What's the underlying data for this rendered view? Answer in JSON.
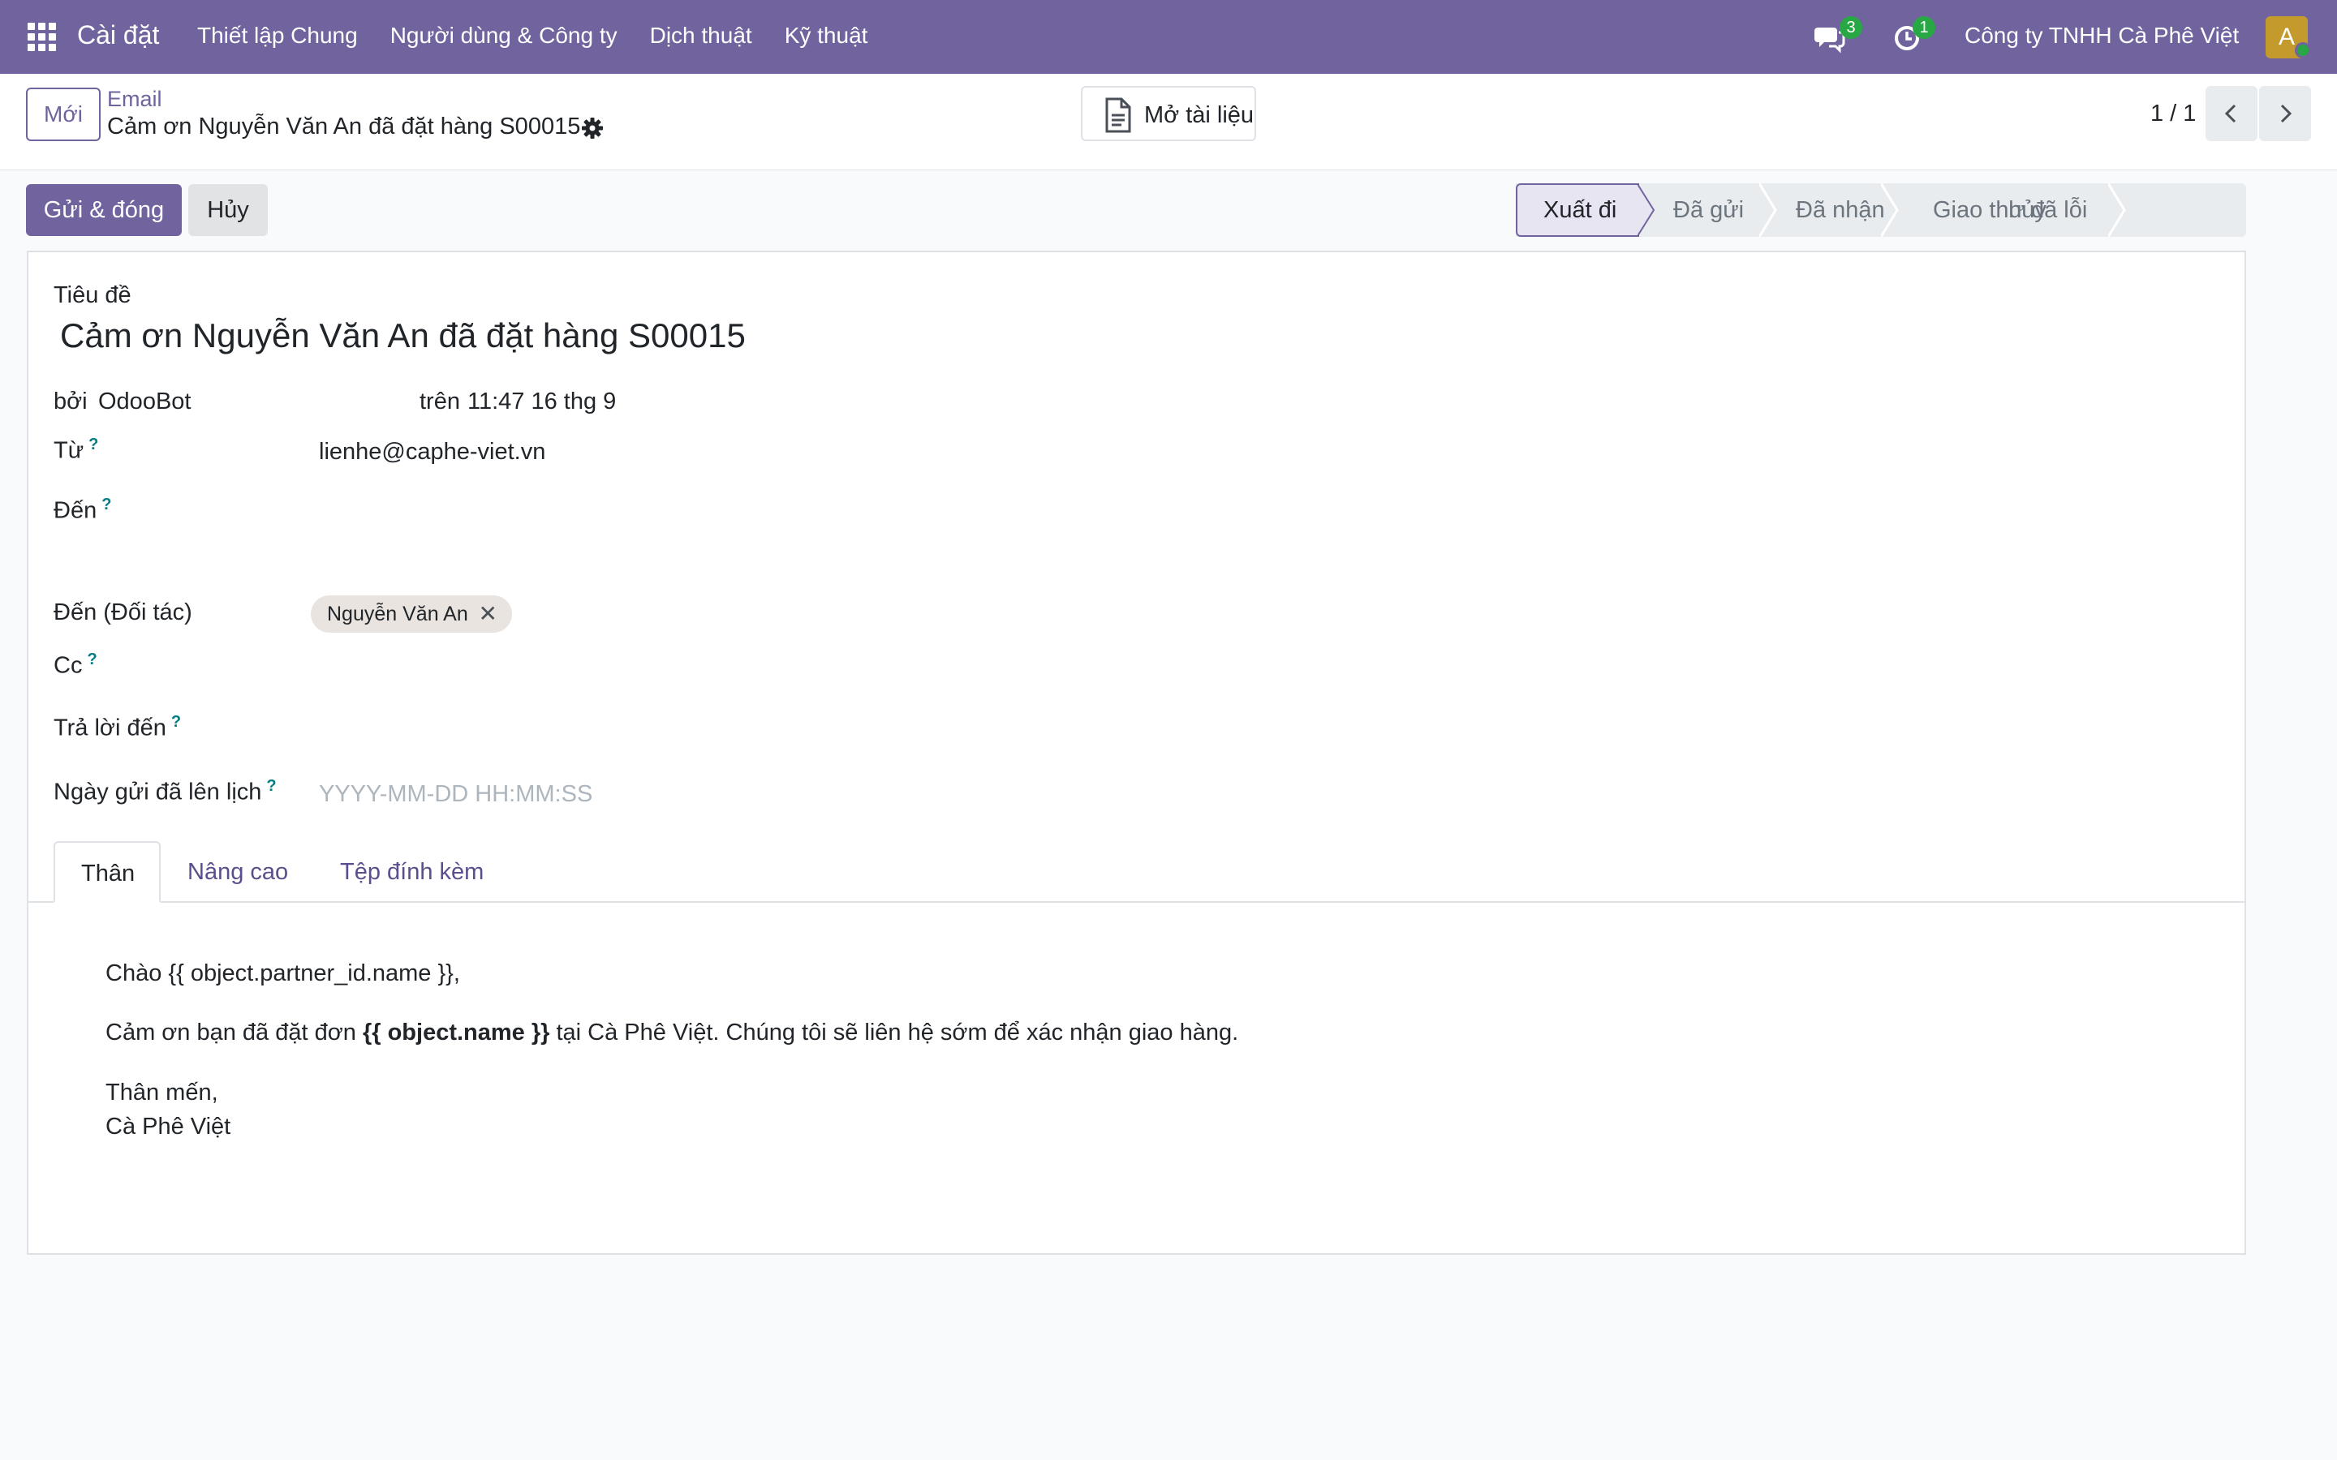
{
  "navbar": {
    "brand": "Cài đặt",
    "menu": [
      "Thiết lập Chung",
      "Người dùng & Công ty",
      "Dịch thuật",
      "Kỹ thuật"
    ],
    "messages_count": "3",
    "activities_count": "1",
    "company": "Công ty TNHH Cà Phê Việt",
    "avatar_letter": "A"
  },
  "control_panel": {
    "new_button": "Mới",
    "breadcrumb_parent": "Email",
    "breadcrumb_current": "Cảm ơn Nguyễn Văn An đã đặt hàng S00015",
    "open_document": "Mở tài liệu",
    "pager": "1 / 1"
  },
  "actions": {
    "send_close": "Gửi & đóng",
    "cancel": "Hủy"
  },
  "statusbar": {
    "stages": [
      "Xuất đi",
      "Đã gửi",
      "Đã nhận",
      "Giao thư đã lỗi",
      "Đã hủy"
    ],
    "active": "Xuất đi"
  },
  "form": {
    "subject_label": "Tiêu đề",
    "subject": "Cảm ơn Nguyễn Văn An đã đặt hàng S00015",
    "by_label": "bởi",
    "author": "OdooBot",
    "on_label": "trên",
    "date": "11:47 16 thg 9",
    "from_label": "Từ",
    "from_value": "lienhe@caphe-viet.vn",
    "to_label": "Đến",
    "to_partner_label": "Đến (Đối tác)",
    "partner_tag": "Nguyễn Văn An",
    "cc_label": "Cc",
    "reply_to_label": "Trả lời đến",
    "scheduled_label": "Ngày gửi đã lên lịch",
    "scheduled_placeholder": "YYYY-MM-DD HH:MM:SS",
    "help_mark": "?"
  },
  "tabs": [
    "Thân",
    "Nâng cao",
    "Tệp đính kèm"
  ],
  "body": {
    "greeting": "Chào {{ object.partner_id.name }},",
    "line_before": "Cảm ơn bạn đã đặt đơn ",
    "line_bold": "{{ object.name }}",
    "line_after": " tại Cà Phê Việt. Chúng tôi sẽ liên hệ sớm để xác nhận giao hàng.",
    "closing": "Thân mến,",
    "signature": "Cà Phê Việt"
  }
}
